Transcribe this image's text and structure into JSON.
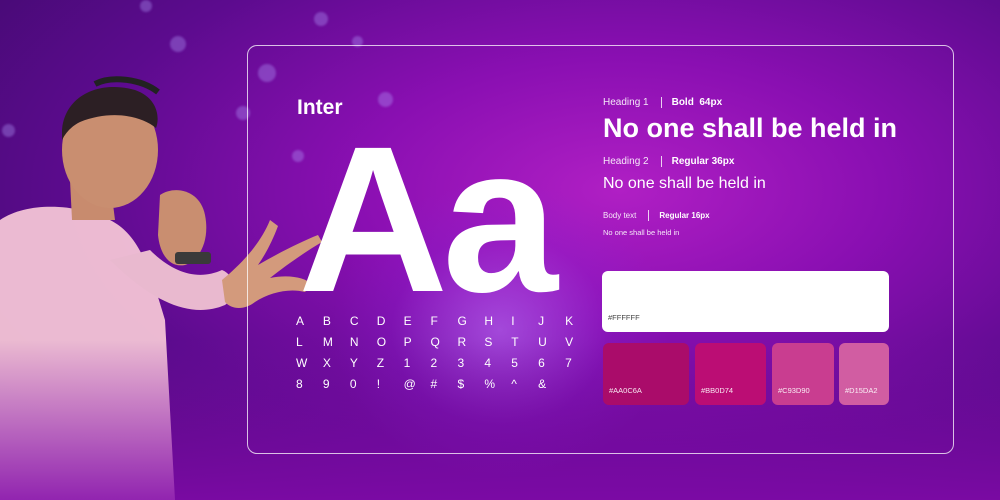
{
  "typeface": {
    "name": "Inter",
    "specimen": "Aa",
    "glyphs": [
      "A",
      "B",
      "C",
      "D",
      "E",
      "F",
      "G",
      "H",
      "I",
      "J",
      "K",
      "L",
      "M",
      "N",
      "O",
      "P",
      "Q",
      "R",
      "S",
      "T",
      "U",
      "V",
      "W",
      "X",
      "Y",
      "Z",
      "1",
      "2",
      "3",
      "4",
      "5",
      "6",
      "7",
      "8",
      "9",
      "0",
      "!",
      "@",
      "#",
      "$",
      "%",
      "^",
      "&"
    ]
  },
  "type_scale": {
    "heading1": {
      "label": "Heading 1",
      "spec": "Bold  64px",
      "sample": "No one shall be held in"
    },
    "heading2": {
      "label": "Heading 2",
      "spec": "Regular 36px",
      "sample": "No one shall be held in"
    },
    "body": {
      "label": "Body text",
      "spec": "Regular 16px",
      "sample": "No one shall be held in"
    }
  },
  "palette": [
    {
      "code": "#FFFFFF",
      "color": "#FFFFFF"
    },
    {
      "code": "#AA0C6A",
      "color": "#AA0C6A"
    },
    {
      "code": "#BB0D74",
      "color": "#BB0D74"
    },
    {
      "code": "#C93D90",
      "color": "#C93D90"
    },
    {
      "code": "#D15DA2",
      "color": "#D15DA2"
    }
  ]
}
